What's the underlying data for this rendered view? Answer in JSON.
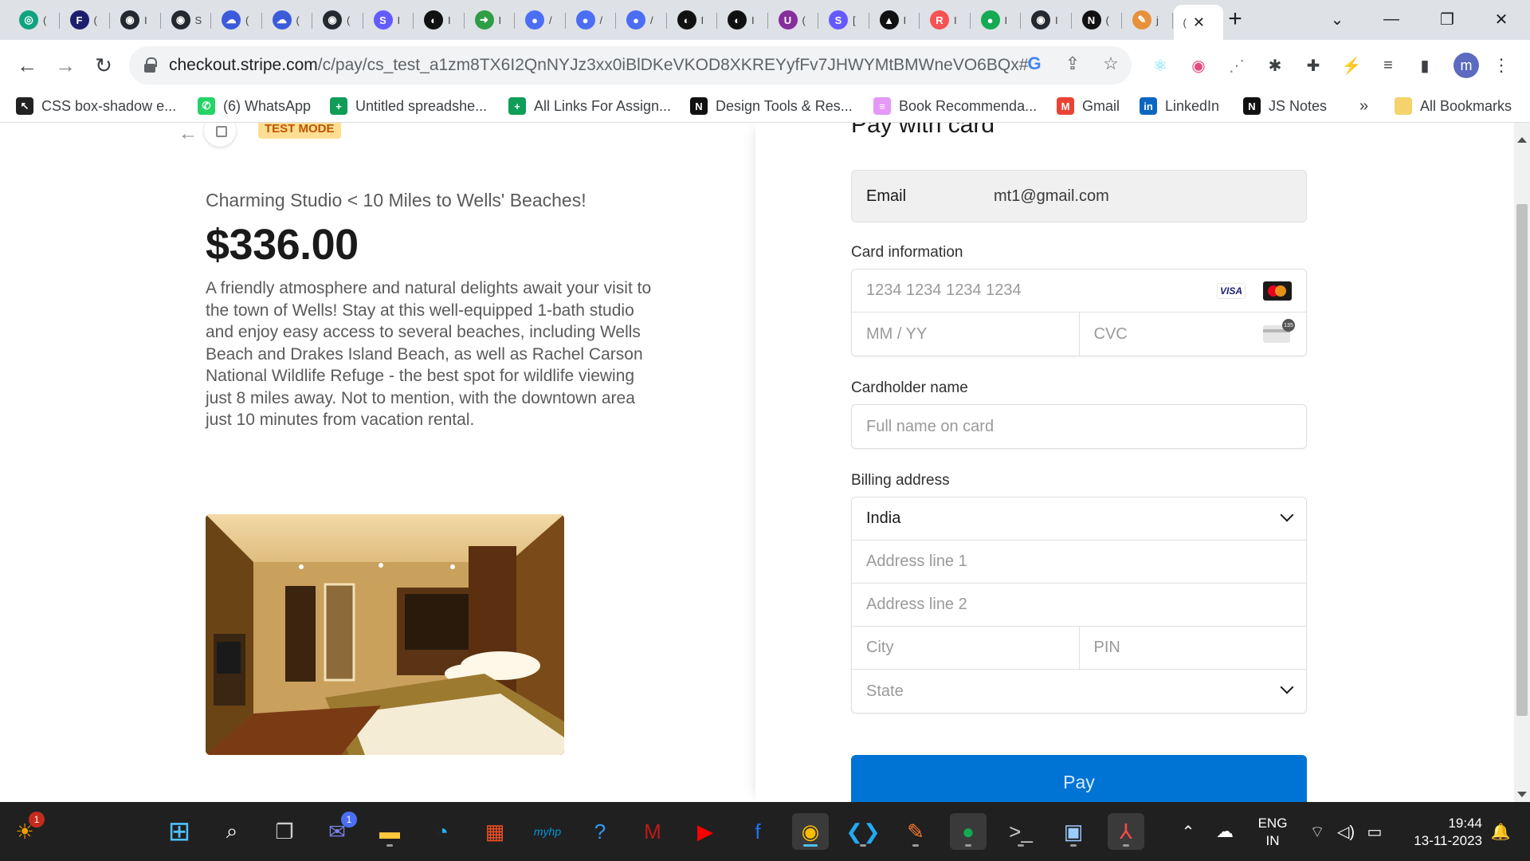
{
  "browser": {
    "tabs": [
      {
        "icon": "openai-icon",
        "color": "#10a37f",
        "glyph": "◎",
        "short": "("
      },
      {
        "icon": "figma-f-icon",
        "color": "#1e1e6e",
        "glyph": "F",
        "short": "("
      },
      {
        "icon": "github-icon",
        "color": "#24292f",
        "glyph": "◉",
        "short": "I"
      },
      {
        "icon": "github-icon",
        "color": "#24292f",
        "glyph": "◉",
        "short": "S"
      },
      {
        "icon": "cloud-icon",
        "color": "#3b5bdb",
        "glyph": "☁",
        "short": "("
      },
      {
        "icon": "cloud-icon",
        "color": "#3b5bdb",
        "glyph": "☁",
        "short": "("
      },
      {
        "icon": "github-icon",
        "color": "#24292f",
        "glyph": "◉",
        "short": "("
      },
      {
        "icon": "stripe-s-icon",
        "color": "#635bff",
        "glyph": "S",
        "short": "I"
      },
      {
        "icon": "record-icon",
        "color": "#111111",
        "glyph": "◐",
        "short": "I"
      },
      {
        "icon": "share-icon",
        "color": "#2f9e44",
        "glyph": "➜",
        "short": "I"
      },
      {
        "icon": "chat-icon",
        "color": "#4c6ef5",
        "glyph": "●",
        "short": "/"
      },
      {
        "icon": "chat-icon",
        "color": "#4c6ef5",
        "glyph": "●",
        "short": "/"
      },
      {
        "icon": "chat-icon",
        "color": "#4c6ef5",
        "glyph": "●",
        "short": "/"
      },
      {
        "icon": "record-icon",
        "color": "#111111",
        "glyph": "◐",
        "short": "I"
      },
      {
        "icon": "record-icon",
        "color": "#111111",
        "glyph": "◐",
        "short": "I"
      },
      {
        "icon": "u-icon",
        "color": "#862e9c",
        "glyph": "U",
        "short": "("
      },
      {
        "icon": "stripe-s-icon",
        "color": "#635bff",
        "glyph": "S",
        "short": "["
      },
      {
        "icon": "vercel-icon",
        "color": "#111111",
        "glyph": "▲",
        "short": "I"
      },
      {
        "icon": "r-icon",
        "color": "#fa5252",
        "glyph": "R",
        "short": "I"
      },
      {
        "icon": "mongodb-icon",
        "color": "#13aa52",
        "glyph": "●",
        "short": "I"
      },
      {
        "icon": "github-icon",
        "color": "#24292f",
        "glyph": "◉",
        "short": "I"
      },
      {
        "icon": "notion-icon",
        "color": "#111111",
        "glyph": "N",
        "short": "("
      },
      {
        "icon": "pen-icon",
        "color": "#e8913a",
        "glyph": "✎",
        "short": "j"
      }
    ],
    "active_tab": {
      "icon": "stripe-tab-icon",
      "short": "("
    },
    "url_host": "checkout.stripe.com",
    "url_path": "/c/pay/cs_test_a1zm8TX6I2QnNYJz3xx0iBlDKeVKOD8XKREYyfFv7JHWYMtBMWneVO6BQx#fi...",
    "bookmarks": [
      {
        "label": "CSS box-shadow e...",
        "icon": "cursor-icon",
        "color": "#222222",
        "glyph": "↖"
      },
      {
        "label": "(6) WhatsApp",
        "icon": "whatsapp-icon",
        "color": "#25d366",
        "glyph": "✆"
      },
      {
        "label": "Untitled spreadshe...",
        "icon": "sheets-icon",
        "color": "#0f9d58",
        "glyph": "+"
      },
      {
        "label": "All Links For Assign...",
        "icon": "sheets-icon",
        "color": "#0f9d58",
        "glyph": "+"
      },
      {
        "label": "Design Tools & Res...",
        "icon": "notion-icon",
        "color": "#111111",
        "glyph": "N"
      },
      {
        "label": "Book Recommenda...",
        "icon": "book-icon",
        "color": "#e599f7",
        "glyph": "≡"
      },
      {
        "label": "Gmail",
        "icon": "gmail-icon",
        "color": "#ea4335",
        "glyph": "M"
      },
      {
        "label": "LinkedIn",
        "icon": "linkedin-icon",
        "color": "#0a66c2",
        "glyph": "in"
      },
      {
        "label": "JS Notes",
        "icon": "notion-icon",
        "color": "#111111",
        "glyph": "N"
      }
    ],
    "more_bookmarks": "»",
    "all_bookmarks": "All Bookmarks",
    "profile_initial": "m"
  },
  "checkout": {
    "test_badge": "TEST MODE",
    "product_name": "Charming Studio < 10 Miles to Wells' Beaches!",
    "price": "$336.00",
    "description": "A friendly atmosphere and natural delights await your visit to the town of Wells! Stay at this well-equipped 1-bath studio and enjoy easy access to several beaches, including Wells Beach and Drakes Island Beach, as well as Rachel Carson National Wildlife Refuge - the best spot for wildlife viewing just 8 miles away. Not to mention, with the downtown area just 10 minutes from vacation rental.",
    "form": {
      "title": "Pay with card",
      "email_label": "Email",
      "email_value": "mt1@gmail.com",
      "card_label": "Card information",
      "card_number_placeholder": "1234 1234 1234 1234",
      "expiry_placeholder": "MM / YY",
      "cvc_placeholder": "CVC",
      "visa_text": "VISA",
      "cardholder_label": "Cardholder name",
      "cardholder_placeholder": "Full name on card",
      "billing_label": "Billing address",
      "country_value": "India",
      "address1_placeholder": "Address line 1",
      "address2_placeholder": "Address line 2",
      "city_placeholder": "City",
      "pin_placeholder": "PIN",
      "state_placeholder": "State",
      "pay_label": "Pay"
    }
  },
  "taskbar": {
    "widget_badge": "1",
    "teams_badge": "1",
    "lang_line1": "ENG",
    "lang_line2": "IN",
    "time": "19:44",
    "date": "13-11-2023"
  }
}
